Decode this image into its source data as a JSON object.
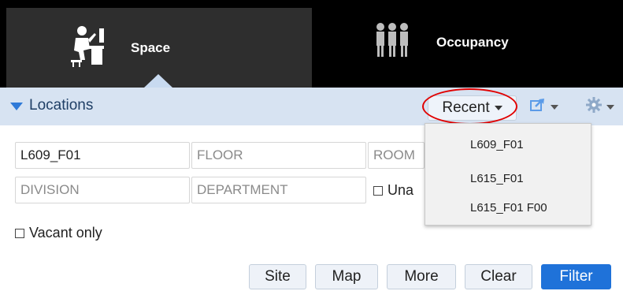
{
  "tabs": [
    {
      "label": "Space",
      "icon": "desk-worker-icon",
      "active": true
    },
    {
      "label": "Occupancy",
      "icon": "people-group-icon",
      "active": false
    }
  ],
  "panel": {
    "title": "Locations",
    "recent_label": "Recent"
  },
  "fields": {
    "site_value": "L609_F01",
    "floor_placeholder": "FLOOR",
    "room_placeholder": "ROOM",
    "division_placeholder": "DIVISION",
    "department_placeholder": "DEPARTMENT"
  },
  "checkboxes": {
    "unassigned_label": "Una",
    "vacant_label": "Vacant only"
  },
  "recent_menu": {
    "items": [
      "L609_F01",
      "L615_F01",
      "L615_F01 F00"
    ]
  },
  "buttons": {
    "site": "Site",
    "map": "Map",
    "more": "More",
    "clear": "Clear",
    "filter": "Filter"
  },
  "colors": {
    "accent": "#1f72d9",
    "header_bg": "#d7e3f2",
    "highlight": "#e10000"
  }
}
